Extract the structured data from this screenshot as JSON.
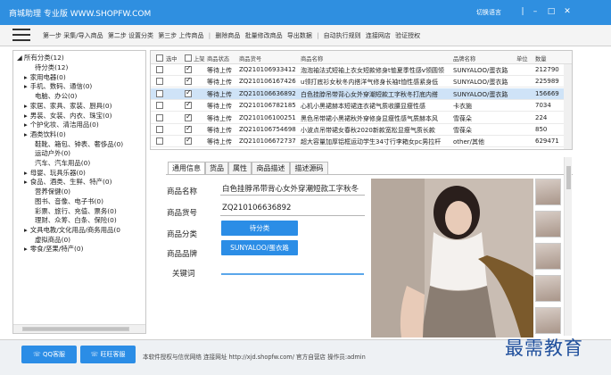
{
  "window": {
    "title": "商城助理 专业版 WWW.SHOPFW.COM",
    "lang_switch": "切换语言",
    "controls": [
      "|",
      "–",
      "□",
      "✕"
    ]
  },
  "toolbar": {
    "items": [
      "第一步 采集/导入商品",
      "第二步 设置分类",
      "第三步 上传商品",
      "|",
      "删除商品",
      "批量修改商品",
      "导出数据",
      "|",
      "自动执行规则",
      "连接网店",
      "验证授权"
    ]
  },
  "tree": {
    "root": "所有分类(12)",
    "nodes": [
      {
        "arrow": "",
        "label": "待分类(12)",
        "indent": 1
      },
      {
        "arrow": "▸",
        "label": "家用电器(0)",
        "indent": 0
      },
      {
        "arrow": "▸",
        "label": "手机、数码、通信(0)",
        "indent": 0
      },
      {
        "arrow": "",
        "label": "电脑、办公(0)",
        "indent": 1
      },
      {
        "arrow": "▸",
        "label": "家居、家具、家装、厨具(0)",
        "indent": 0
      },
      {
        "arrow": "▸",
        "label": "男装、女装、内衣、珠宝(0)",
        "indent": 0
      },
      {
        "arrow": "▸",
        "label": "个护化妆、清洁用品(0)",
        "indent": 0
      },
      {
        "arrow": "▸",
        "label": "酒类饮料(0)",
        "indent": 0
      },
      {
        "arrow": "",
        "label": "鞋靴、箱包、钟表、奢侈品(0)",
        "indent": 1
      },
      {
        "arrow": "",
        "label": "运动户外(0)",
        "indent": 1
      },
      {
        "arrow": "",
        "label": "汽车、汽车用品(0)",
        "indent": 1
      },
      {
        "arrow": "▸",
        "label": "母婴、玩具乐器(0)",
        "indent": 0
      },
      {
        "arrow": "▸",
        "label": "食品、酒类、生鲜、特产(0)",
        "indent": 0
      },
      {
        "arrow": "",
        "label": "营养保健(0)",
        "indent": 1
      },
      {
        "arrow": "",
        "label": "图书、音像、电子书(0)",
        "indent": 1
      },
      {
        "arrow": "",
        "label": "彩票、旅行、充值、票务(0)",
        "indent": 1
      },
      {
        "arrow": "",
        "label": "理财、众筹、白条、保险(0)",
        "indent": 1
      },
      {
        "arrow": "▸",
        "label": "文具电教/文化用品/商务用品(0",
        "indent": 0
      },
      {
        "arrow": "",
        "label": "虚拟商品(0)",
        "indent": 1
      },
      {
        "arrow": "▸",
        "label": "零食/坚果/特产(0)",
        "indent": 0
      }
    ]
  },
  "grid": {
    "headers": {
      "select": "选中",
      "upload": "上架",
      "status": "商品状态",
      "sku": "商品货号",
      "name": "商品名称",
      "brand": "品牌名称",
      "unit": "单位",
      "qty": "数量"
    },
    "rows": [
      {
        "selected": false,
        "upload": true,
        "highlight": false,
        "status": "等待上传",
        "sku": "ZQ210106933412",
        "name": "泡泡袖法式短袖上衣女短款修身t恤夏季性感v领圆领",
        "brand": "SUNYALOO/蛋衣路",
        "unit": "",
        "qty": "212790"
      },
      {
        "selected": false,
        "upload": true,
        "highlight": false,
        "status": "等待上传",
        "sku": "ZQ210106167426",
        "name": "u领打底衫女秋冬内搭洋气修身长袖t恤性感紧身低",
        "brand": "SUNYALOO/蛋衣路",
        "unit": "",
        "qty": "225989"
      },
      {
        "selected": false,
        "upload": true,
        "highlight": true,
        "status": "等待上传",
        "sku": "ZQ210106636892",
        "name": "白色挂脖吊带背心女外穿潮短款工字秋冬打底内搭",
        "brand": "SUNYALOO/蛋衣路",
        "unit": "",
        "qty": "156669"
      },
      {
        "selected": false,
        "upload": true,
        "highlight": false,
        "status": "等待上传",
        "sku": "ZQ210106782185",
        "name": "心机小黑裙赫本短裙连衣裙气质收腰显瘦性感",
        "brand": "卡衣施",
        "unit": "",
        "qty": "7034"
      },
      {
        "selected": false,
        "upload": true,
        "highlight": false,
        "status": "等待上传",
        "sku": "ZQ210106100251",
        "name": "黑色吊带裙小黑裙秋外穿修身显瘦性感气质赫本风",
        "brand": "雪葆朵",
        "unit": "",
        "qty": "224"
      },
      {
        "selected": false,
        "upload": true,
        "highlight": false,
        "status": "等待上传",
        "sku": "ZQ210106754698",
        "name": "小波点吊带裙女春秋2020新款宽松显瘦气质长款",
        "brand": "雪葆朵",
        "unit": "",
        "qty": "850"
      },
      {
        "selected": false,
        "upload": true,
        "highlight": false,
        "status": "等待上传",
        "sku": "ZQ210106672737",
        "name": "超大容量加厚铝框运动学生34寸行李箱女pc男拉杆",
        "brand": "other/其他",
        "unit": "",
        "qty": "629471"
      }
    ]
  },
  "tabs": [
    "通用信息",
    "货品",
    "属性",
    "商品描述",
    "描述源码"
  ],
  "form": {
    "name_label": "商品名称",
    "name_value": "白色挂脖吊带背心女外穿潮短款工字秋冬",
    "sku_label": "商品货号",
    "sku_value": "ZQ210106636892",
    "category_label": "商品分类",
    "category_btn": "待分类",
    "brand_label": "商品品牌",
    "brand_btn": "SUNYALOO/蛋衣路",
    "keywords_label": "关键词"
  },
  "bottom": {
    "qq1": "QQ客服",
    "qq2": "旺旺客服",
    "status": "本软件授权与信优网络   连接网址 http://xjd.shopfw.com/ 官方自营店 操作员:admin"
  },
  "watermark": "最需教育"
}
